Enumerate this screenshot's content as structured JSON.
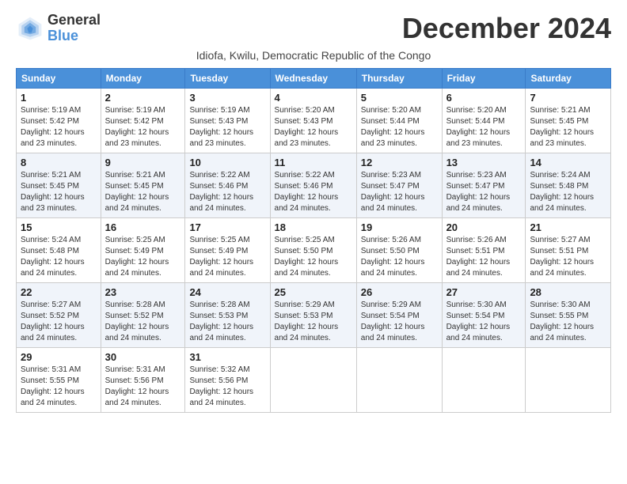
{
  "header": {
    "logo_general": "General",
    "logo_blue": "Blue",
    "title": "December 2024",
    "subtitle": "Idiofa, Kwilu, Democratic Republic of the Congo"
  },
  "weekdays": [
    "Sunday",
    "Monday",
    "Tuesday",
    "Wednesday",
    "Thursday",
    "Friday",
    "Saturday"
  ],
  "weeks": [
    [
      {
        "day": "1",
        "sunrise": "5:19 AM",
        "sunset": "5:42 PM",
        "daylight": "12 hours and 23 minutes."
      },
      {
        "day": "2",
        "sunrise": "5:19 AM",
        "sunset": "5:42 PM",
        "daylight": "12 hours and 23 minutes."
      },
      {
        "day": "3",
        "sunrise": "5:19 AM",
        "sunset": "5:43 PM",
        "daylight": "12 hours and 23 minutes."
      },
      {
        "day": "4",
        "sunrise": "5:20 AM",
        "sunset": "5:43 PM",
        "daylight": "12 hours and 23 minutes."
      },
      {
        "day": "5",
        "sunrise": "5:20 AM",
        "sunset": "5:44 PM",
        "daylight": "12 hours and 23 minutes."
      },
      {
        "day": "6",
        "sunrise": "5:20 AM",
        "sunset": "5:44 PM",
        "daylight": "12 hours and 23 minutes."
      },
      {
        "day": "7",
        "sunrise": "5:21 AM",
        "sunset": "5:45 PM",
        "daylight": "12 hours and 23 minutes."
      }
    ],
    [
      {
        "day": "8",
        "sunrise": "5:21 AM",
        "sunset": "5:45 PM",
        "daylight": "12 hours and 23 minutes."
      },
      {
        "day": "9",
        "sunrise": "5:21 AM",
        "sunset": "5:45 PM",
        "daylight": "12 hours and 24 minutes."
      },
      {
        "day": "10",
        "sunrise": "5:22 AM",
        "sunset": "5:46 PM",
        "daylight": "12 hours and 24 minutes."
      },
      {
        "day": "11",
        "sunrise": "5:22 AM",
        "sunset": "5:46 PM",
        "daylight": "12 hours and 24 minutes."
      },
      {
        "day": "12",
        "sunrise": "5:23 AM",
        "sunset": "5:47 PM",
        "daylight": "12 hours and 24 minutes."
      },
      {
        "day": "13",
        "sunrise": "5:23 AM",
        "sunset": "5:47 PM",
        "daylight": "12 hours and 24 minutes."
      },
      {
        "day": "14",
        "sunrise": "5:24 AM",
        "sunset": "5:48 PM",
        "daylight": "12 hours and 24 minutes."
      }
    ],
    [
      {
        "day": "15",
        "sunrise": "5:24 AM",
        "sunset": "5:48 PM",
        "daylight": "12 hours and 24 minutes."
      },
      {
        "day": "16",
        "sunrise": "5:25 AM",
        "sunset": "5:49 PM",
        "daylight": "12 hours and 24 minutes."
      },
      {
        "day": "17",
        "sunrise": "5:25 AM",
        "sunset": "5:49 PM",
        "daylight": "12 hours and 24 minutes."
      },
      {
        "day": "18",
        "sunrise": "5:25 AM",
        "sunset": "5:50 PM",
        "daylight": "12 hours and 24 minutes."
      },
      {
        "day": "19",
        "sunrise": "5:26 AM",
        "sunset": "5:50 PM",
        "daylight": "12 hours and 24 minutes."
      },
      {
        "day": "20",
        "sunrise": "5:26 AM",
        "sunset": "5:51 PM",
        "daylight": "12 hours and 24 minutes."
      },
      {
        "day": "21",
        "sunrise": "5:27 AM",
        "sunset": "5:51 PM",
        "daylight": "12 hours and 24 minutes."
      }
    ],
    [
      {
        "day": "22",
        "sunrise": "5:27 AM",
        "sunset": "5:52 PM",
        "daylight": "12 hours and 24 minutes."
      },
      {
        "day": "23",
        "sunrise": "5:28 AM",
        "sunset": "5:52 PM",
        "daylight": "12 hours and 24 minutes."
      },
      {
        "day": "24",
        "sunrise": "5:28 AM",
        "sunset": "5:53 PM",
        "daylight": "12 hours and 24 minutes."
      },
      {
        "day": "25",
        "sunrise": "5:29 AM",
        "sunset": "5:53 PM",
        "daylight": "12 hours and 24 minutes."
      },
      {
        "day": "26",
        "sunrise": "5:29 AM",
        "sunset": "5:54 PM",
        "daylight": "12 hours and 24 minutes."
      },
      {
        "day": "27",
        "sunrise": "5:30 AM",
        "sunset": "5:54 PM",
        "daylight": "12 hours and 24 minutes."
      },
      {
        "day": "28",
        "sunrise": "5:30 AM",
        "sunset": "5:55 PM",
        "daylight": "12 hours and 24 minutes."
      }
    ],
    [
      {
        "day": "29",
        "sunrise": "5:31 AM",
        "sunset": "5:55 PM",
        "daylight": "12 hours and 24 minutes."
      },
      {
        "day": "30",
        "sunrise": "5:31 AM",
        "sunset": "5:56 PM",
        "daylight": "12 hours and 24 minutes."
      },
      {
        "day": "31",
        "sunrise": "5:32 AM",
        "sunset": "5:56 PM",
        "daylight": "12 hours and 24 minutes."
      },
      null,
      null,
      null,
      null
    ]
  ]
}
